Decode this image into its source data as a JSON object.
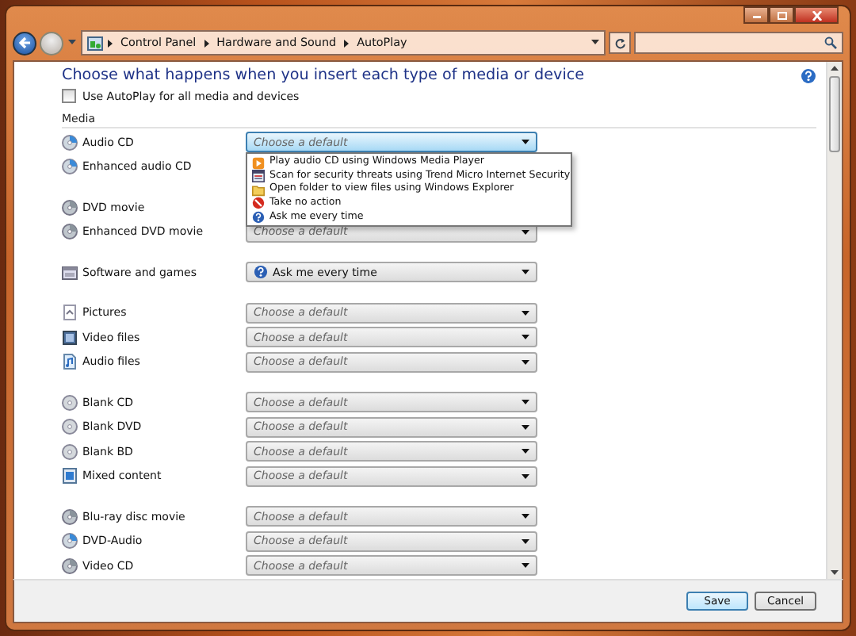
{
  "address_bar": {
    "path": [
      "Control Panel",
      "Hardware and Sound",
      "AutoPlay"
    ]
  },
  "heading": "Choose what happens when you insert each type of media or device",
  "autoplay_all": {
    "label": "Use AutoPlay for all media and devices",
    "checked": false
  },
  "section": "Media",
  "groups": [
    [
      {
        "label": "Audio CD",
        "kind": "disc",
        "placeholder": "Choose a default",
        "expanded": true,
        "options": [
          {
            "label": "Play audio CD using Windows Media Player",
            "kind": "play"
          },
          {
            "label": "Scan for security threats using Trend Micro Internet Security",
            "kind": "scan"
          },
          {
            "label": "Open folder to view files using Windows Explorer",
            "kind": "folder"
          },
          {
            "label": "Take no action",
            "kind": "block"
          },
          {
            "label": "Ask me every time",
            "kind": "help"
          }
        ]
      },
      {
        "label": "Enhanced audio CD",
        "kind": "disc"
      }
    ],
    [
      {
        "label": "DVD movie",
        "kind": "dvd"
      },
      {
        "label": "Enhanced DVD movie",
        "kind": "dvd",
        "placeholder": "Choose a default",
        "expanded": false
      }
    ],
    [
      {
        "label": "Software and games",
        "kind": "software",
        "value": "Ask me every time",
        "expanded": false
      }
    ],
    [
      {
        "label": "Pictures",
        "kind": "picture",
        "placeholder": "Choose a default",
        "expanded": false
      },
      {
        "label": "Video files",
        "kind": "video",
        "placeholder": "Choose a default",
        "expanded": false
      },
      {
        "label": "Audio files",
        "kind": "audio",
        "placeholder": "Choose a default",
        "expanded": false
      }
    ],
    [
      {
        "label": "Blank CD",
        "kind": "blank",
        "placeholder": "Choose a default",
        "expanded": false
      },
      {
        "label": "Blank DVD",
        "kind": "blank",
        "placeholder": "Choose a default",
        "expanded": false
      },
      {
        "label": "Blank BD",
        "kind": "blank",
        "placeholder": "Choose a default",
        "expanded": false
      },
      {
        "label": "Mixed content",
        "kind": "mixed",
        "placeholder": "Choose a default",
        "expanded": false
      }
    ],
    [
      {
        "label": "Blu-ray disc movie",
        "kind": "dvd",
        "placeholder": "Choose a default",
        "expanded": false
      },
      {
        "label": "DVD-Audio",
        "kind": "disc",
        "placeholder": "Choose a default",
        "expanded": false
      },
      {
        "label": "Video CD",
        "kind": "dvd",
        "placeholder": "Choose a default",
        "expanded": false
      }
    ]
  ],
  "buttons": [
    {
      "label": "Save",
      "kind": "default"
    },
    {
      "label": "Cancel",
      "kind": "normal"
    }
  ]
}
